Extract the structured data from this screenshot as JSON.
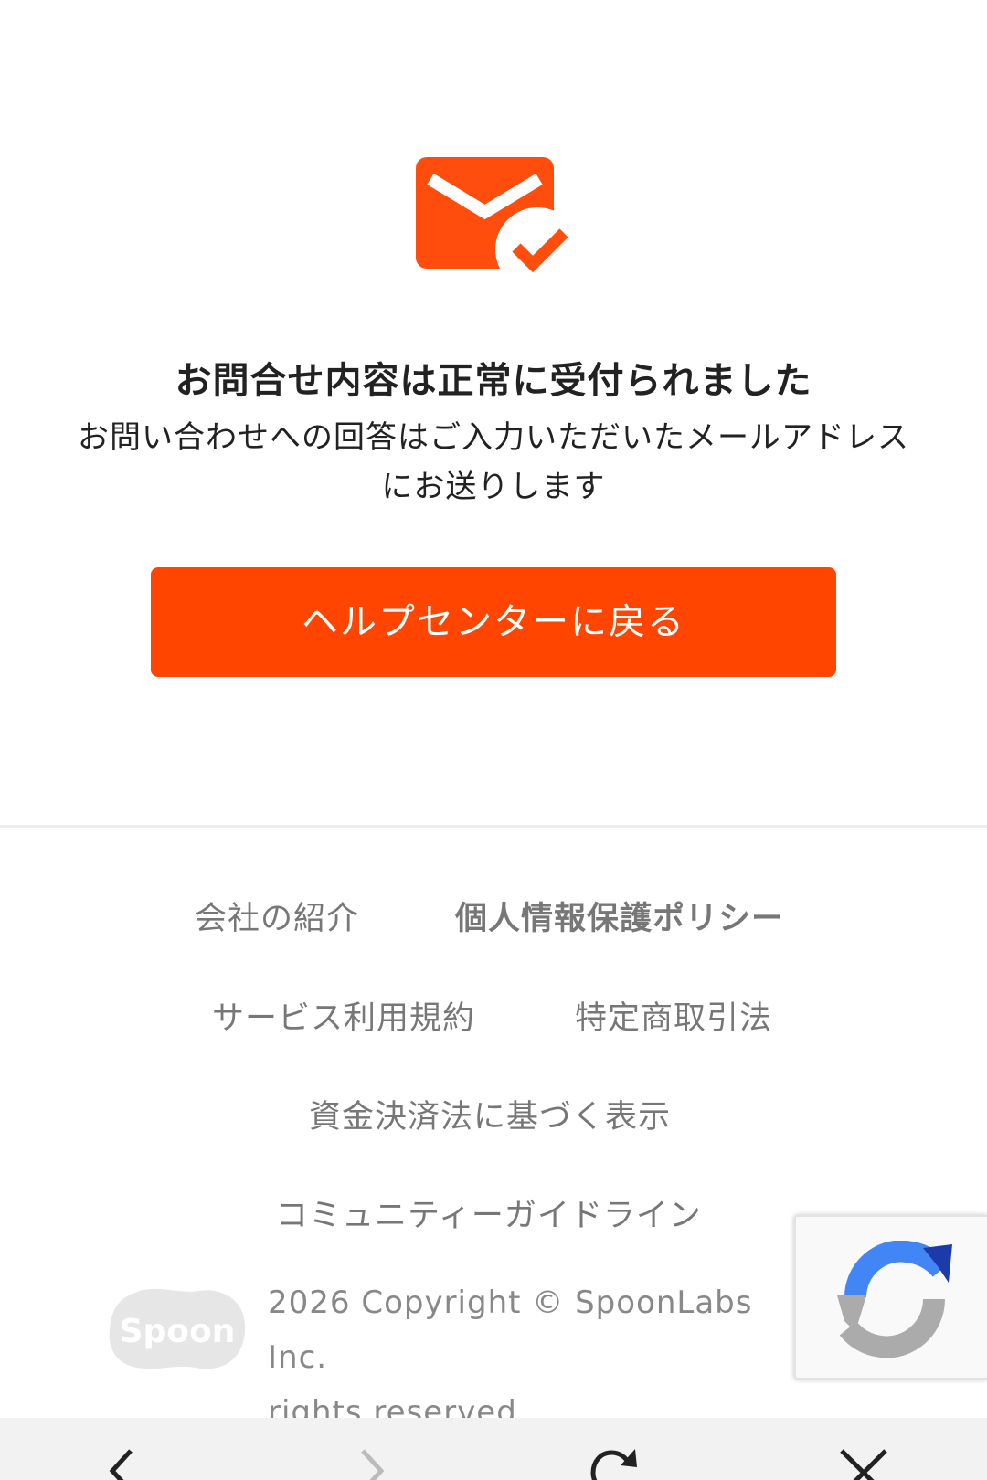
{
  "confirmation": {
    "title": "お問合せ内容は正常に受付られました",
    "description_line1": "お問い合わせへの回答はご入力いただいたメールアドレス",
    "description_line2": "にお送りします",
    "back_button_label": "ヘルプセンターに戻る",
    "icon": "mail-check-icon"
  },
  "footer": {
    "links": [
      {
        "label": "会社の紹介"
      },
      {
        "label": "個人情報保護ポリシー"
      },
      {
        "label": "サービス利用規約"
      },
      {
        "label": "特定商取引法"
      },
      {
        "label": "資金決済法に基づく表示"
      },
      {
        "label": "コミュニティーガイドライン"
      }
    ],
    "logo_text": "Spoon",
    "copyright_line1": "2026 Copyright © SpoonLabs Inc.",
    "copyright_line2": "rights reserved."
  },
  "browser_toolbar": {
    "icons": [
      "back-arrow-icon",
      "forward-arrow-icon",
      "reload-icon",
      "close-icon"
    ]
  },
  "colors": {
    "accent": "#ff4500",
    "icon": "#ff4d0d",
    "footer_text": "#777777",
    "recaptcha_blue": "#4285f4",
    "recaptcha_dark_blue": "#1c3aa9",
    "recaptcha_gray": "#ababab"
  }
}
